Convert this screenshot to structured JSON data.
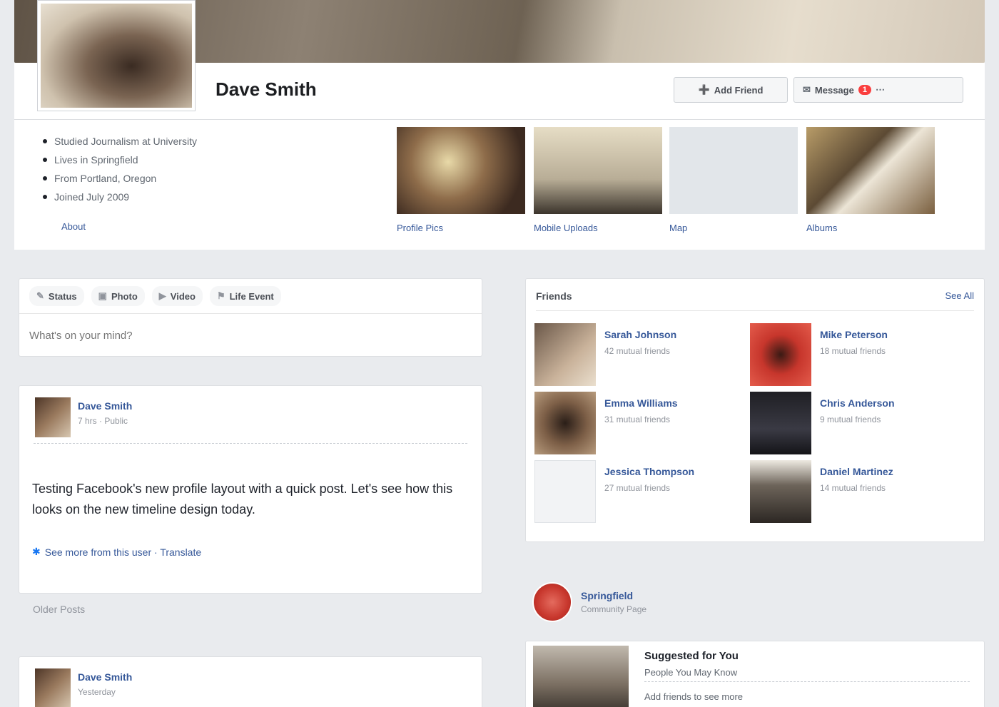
{
  "profile": {
    "name": "Dave Smith",
    "friend_button": "Add Friend",
    "message_button": "Message",
    "message_badge": "1"
  },
  "about": {
    "items": [
      "Studied Journalism at University",
      "Lives in Springfield",
      "From Portland, Oregon",
      "Joined July 2009"
    ],
    "link": "About"
  },
  "photos": {
    "captions": [
      "Profile Pics",
      "Mobile Uploads",
      "Map",
      "Albums"
    ]
  },
  "composer": {
    "tabs": [
      "Status",
      "Photo",
      "Video",
      "Life Event"
    ],
    "placeholder": "What's on your mind?"
  },
  "post": {
    "author": "Dave Smith",
    "meta": "7 hrs · Public",
    "text": "Testing Facebook's new profile layout with a quick post. Let's see how this looks on the new timeline design today.",
    "link_text": "See more from this user · Translate"
  },
  "older_label": "Older Posts",
  "post2": {
    "author": "Dave Smith",
    "meta": "Yesterday"
  },
  "friends": {
    "title": "Friends",
    "see_all": "See All",
    "list": [
      {
        "name": "Sarah Johnson",
        "meta": "42 mutual friends"
      },
      {
        "name": "Mike Peterson",
        "meta": "18 mutual friends"
      },
      {
        "name": "Emma Williams",
        "meta": "31 mutual friends"
      },
      {
        "name": "Chris Anderson",
        "meta": "9 mutual friends"
      },
      {
        "name": "Jessica Thompson",
        "meta": "27 mutual friends"
      },
      {
        "name": "Daniel Martinez",
        "meta": "14 mutual friends"
      }
    ]
  },
  "page": {
    "name": "Springfield",
    "meta": "Community Page"
  },
  "suggestion": {
    "title": "Suggested for You",
    "subtitle": "People You May Know",
    "footer": "Add friends to see more"
  },
  "colors": {
    "link": "#365899",
    "badge": "#fa3e3e",
    "background": "#e9ebee"
  }
}
